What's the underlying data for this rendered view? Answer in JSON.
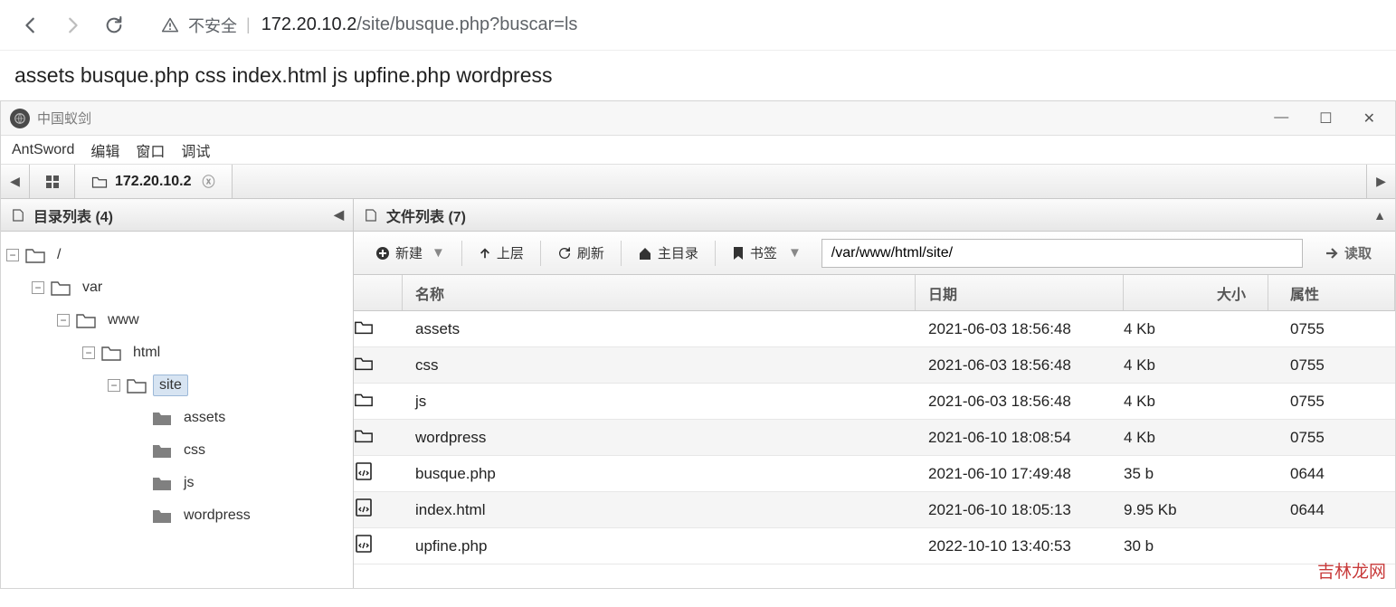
{
  "browser": {
    "not_secure_label": "不安全",
    "url_host": "172.20.10.2",
    "url_path": "/site/busque.php?buscar=ls"
  },
  "page_output": "assets busque.php css index.html js upfine.php wordpress",
  "app": {
    "title": "中国蚁剑",
    "menu": {
      "brand": "AntSword",
      "edit": "编辑",
      "window": "窗口",
      "debug": "调试"
    },
    "tab_label": "172.20.10.2"
  },
  "left_panel": {
    "title": "目录列表 (4)",
    "tree": [
      {
        "depth": 0,
        "label": "/",
        "open": true,
        "solid": false
      },
      {
        "depth": 1,
        "label": "var",
        "open": true,
        "solid": false
      },
      {
        "depth": 2,
        "label": "www",
        "open": true,
        "solid": false
      },
      {
        "depth": 3,
        "label": "html",
        "open": true,
        "solid": false
      },
      {
        "depth": 4,
        "label": "site",
        "open": true,
        "solid": false,
        "selected": true
      },
      {
        "depth": 5,
        "label": "assets",
        "open": false,
        "solid": true,
        "leaf": true
      },
      {
        "depth": 5,
        "label": "css",
        "open": false,
        "solid": true,
        "leaf": true
      },
      {
        "depth": 5,
        "label": "js",
        "open": false,
        "solid": true,
        "leaf": true
      },
      {
        "depth": 5,
        "label": "wordpress",
        "open": false,
        "solid": true,
        "leaf": true
      }
    ]
  },
  "right_panel": {
    "title": "文件列表 (7)",
    "toolbar": {
      "new": "新建",
      "up": "上层",
      "refresh": "刷新",
      "home": "主目录",
      "bookmark": "书签",
      "path": "/var/www/html/site/",
      "read": "读取"
    },
    "columns": {
      "name": "名称",
      "date": "日期",
      "size": "大小",
      "attr": "属性"
    },
    "rows": [
      {
        "icon": "folder",
        "name": "assets",
        "date": "2021-06-03 18:56:48",
        "size": "4 Kb",
        "attr": "0755"
      },
      {
        "icon": "folder",
        "name": "css",
        "date": "2021-06-03 18:56:48",
        "size": "4 Kb",
        "attr": "0755"
      },
      {
        "icon": "folder",
        "name": "js",
        "date": "2021-06-03 18:56:48",
        "size": "4 Kb",
        "attr": "0755"
      },
      {
        "icon": "folder",
        "name": "wordpress",
        "date": "2021-06-10 18:08:54",
        "size": "4 Kb",
        "attr": "0755"
      },
      {
        "icon": "code",
        "name": "busque.php",
        "date": "2021-06-10 17:49:48",
        "size": "35 b",
        "attr": "0644"
      },
      {
        "icon": "code",
        "name": "index.html",
        "date": "2021-06-10 18:05:13",
        "size": "9.95 Kb",
        "attr": "0644"
      },
      {
        "icon": "code",
        "name": "upfine.php",
        "date": "2022-10-10 13:40:53",
        "size": "30 b",
        "attr": ""
      }
    ]
  },
  "watermark": "吉林龙网"
}
